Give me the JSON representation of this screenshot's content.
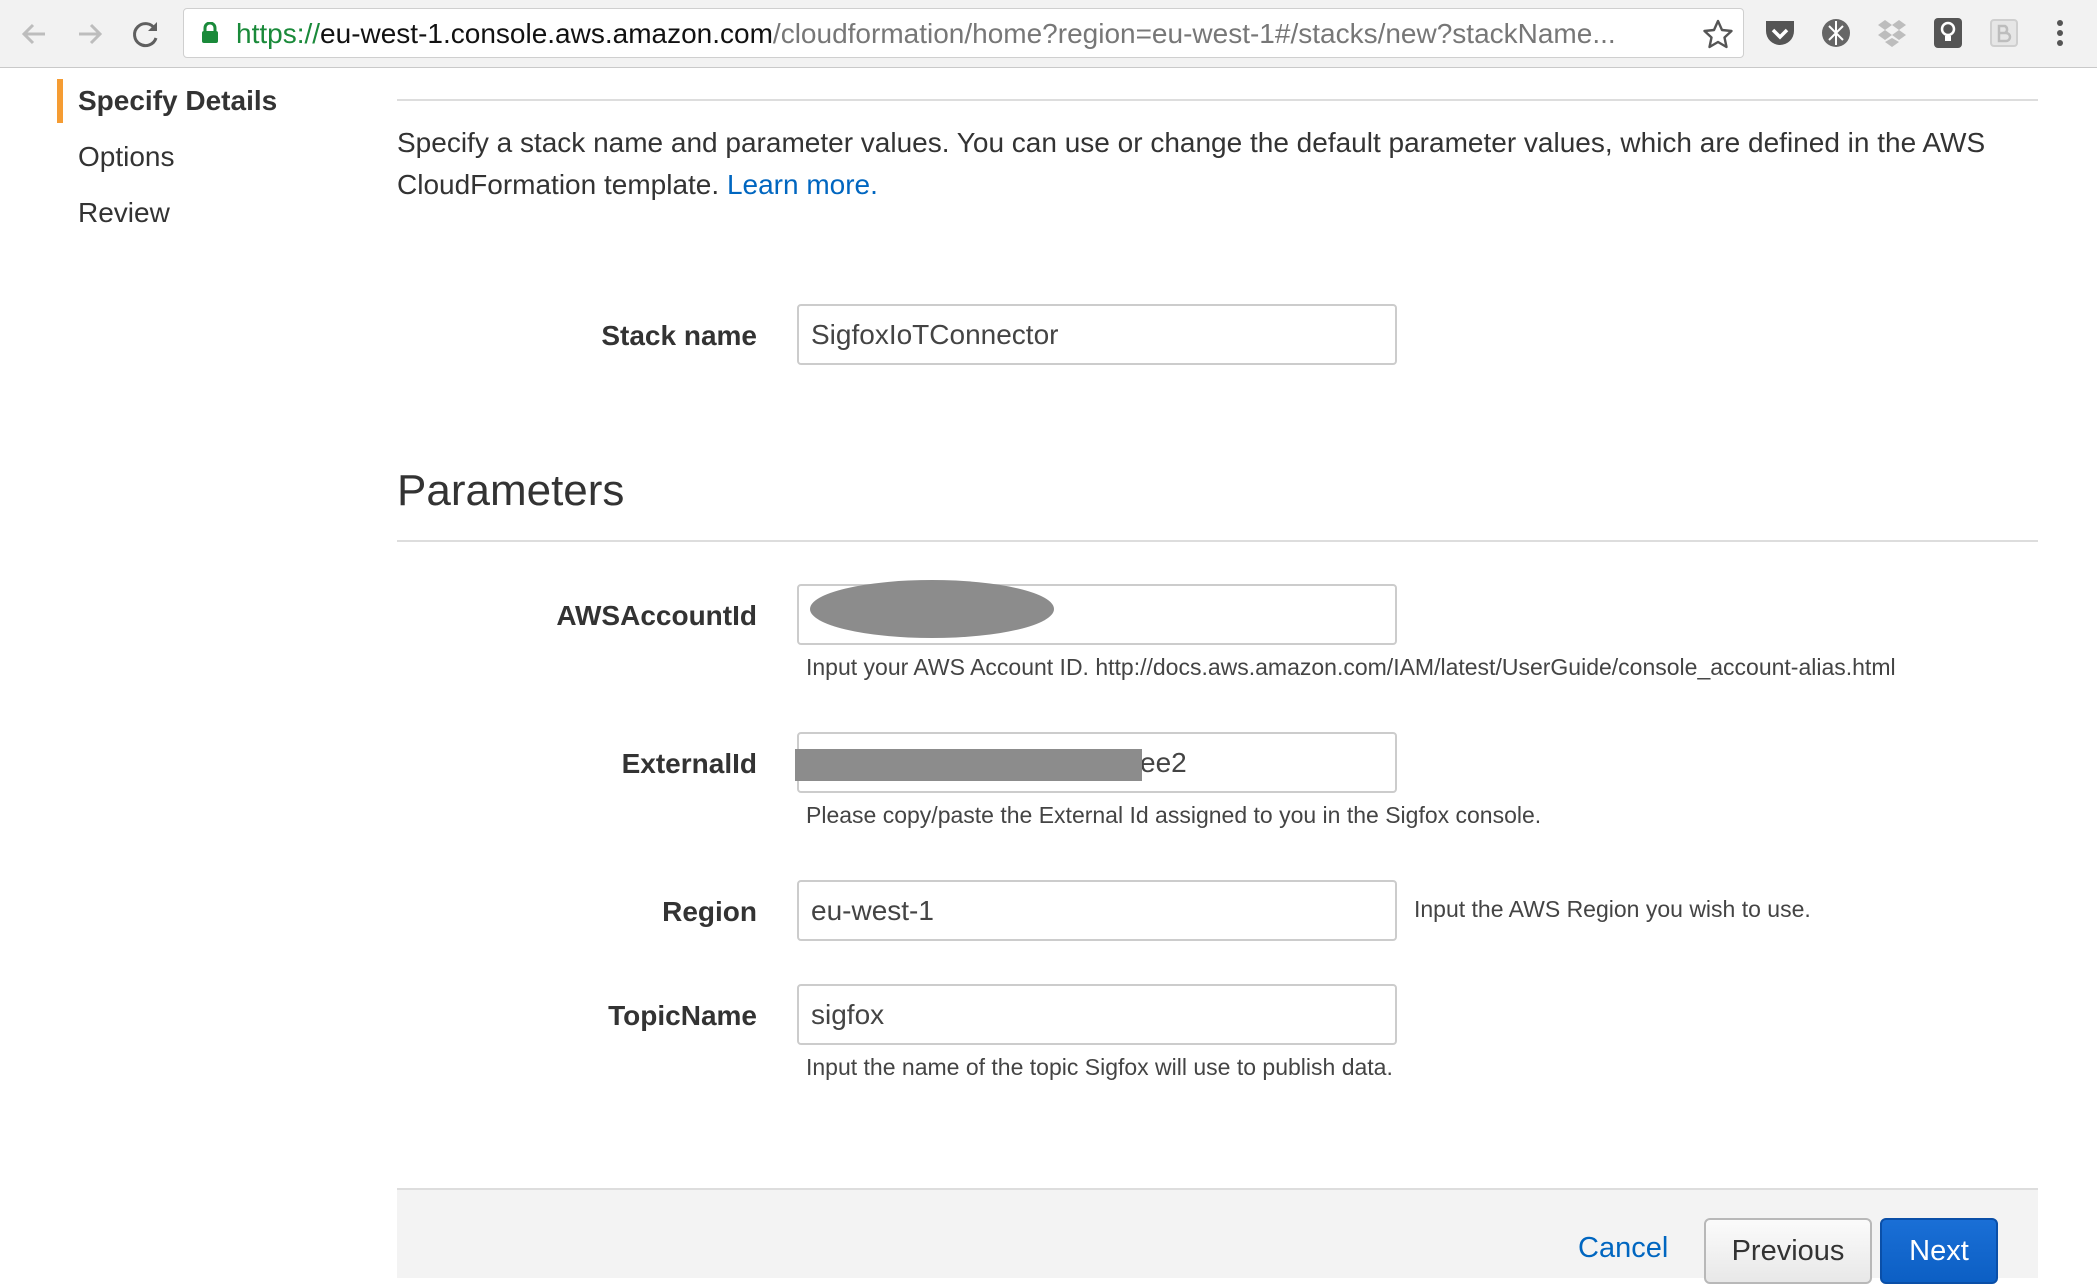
{
  "browser": {
    "url_scheme": "https://",
    "url_host": "eu-west-1.console.aws.amazon.com",
    "url_path": "/cloudformation/home?region=eu-west-1#/stacks/new?stackName...",
    "extensions": [
      "pocket-icon",
      "tracker-icon",
      "dropbox-icon",
      "lightbulb-icon",
      "reader-icon"
    ],
    "menu_icon": "kebab-menu-icon"
  },
  "wizard_nav": {
    "steps": [
      {
        "label": "Specify Details",
        "active": true
      },
      {
        "label": "Options",
        "active": false
      },
      {
        "label": "Review",
        "active": false
      }
    ],
    "accent_color": "#f59c33"
  },
  "main": {
    "intro_text": "Specify a stack name and parameter values. You can use or change the default parameter values, which are defined in the AWS CloudFormation template.",
    "learn_more": "Learn more.",
    "stack_name": {
      "label": "Stack name",
      "value": "SigfoxIoTConnector"
    },
    "parameters_title": "Parameters",
    "parameters": [
      {
        "label": "AWSAccountId",
        "value": "",
        "help": "Input your AWS Account ID. http://docs.aws.amazon.com/IAM/latest/UserGuide/console_account-alias.html",
        "redacted": true
      },
      {
        "label": "ExternalId",
        "value": "ee2",
        "help": "Please copy/paste the External Id assigned to you in the Sigfox console.",
        "redacted": true
      },
      {
        "label": "Region",
        "value": "eu-west-1",
        "help": "Input the AWS Region you wish to use."
      },
      {
        "label": "TopicName",
        "value": "sigfox",
        "help": "Input the name of the topic Sigfox will use to publish data."
      }
    ]
  },
  "footer": {
    "cancel": "Cancel",
    "previous": "Previous",
    "next": "Next",
    "primary_color": "#1166cc",
    "link_color": "#0066c0"
  }
}
